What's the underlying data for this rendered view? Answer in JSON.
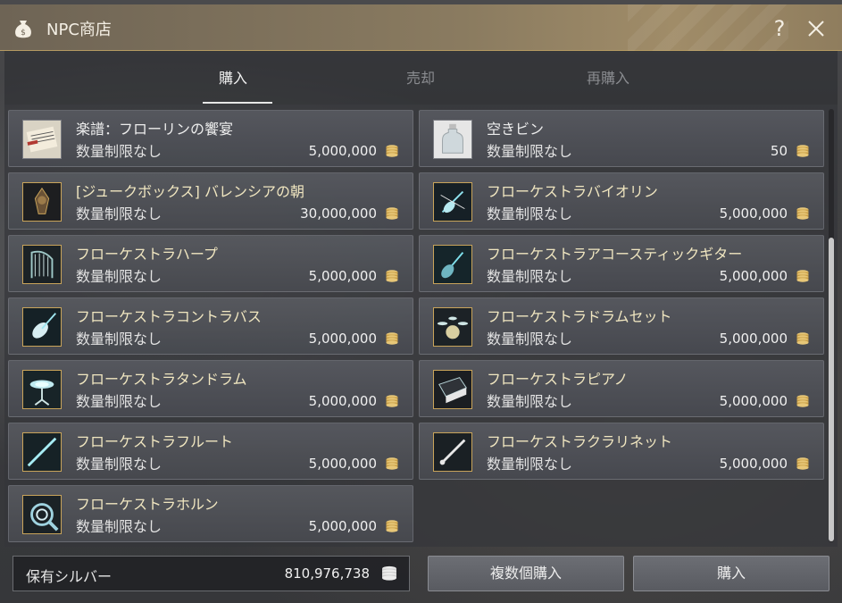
{
  "window": {
    "title": "NPC商店",
    "help_label": "?",
    "title_icon": "money-bag-icon",
    "close_icon": "close-icon"
  },
  "tabs": [
    {
      "label": "購入",
      "active": true
    },
    {
      "label": "売却",
      "active": false
    },
    {
      "label": "再購入",
      "active": false
    }
  ],
  "items": [
    {
      "name": "楽譜：フローリンの饗宴",
      "limit": "数量制限なし",
      "price": "5,000,000",
      "icon": "music-score-icon",
      "name_color": "white"
    },
    {
      "name": "空きビン",
      "limit": "数量制限なし",
      "price": "50",
      "icon": "empty-bottle-icon",
      "name_color": "white"
    },
    {
      "name": "[ジュークボックス] バレンシアの朝",
      "limit": "数量制限なし",
      "price": "30,000,000",
      "icon": "jukebox-icon",
      "name_color": "gold"
    },
    {
      "name": "フローケストラバイオリン",
      "limit": "数量制限なし",
      "price": "5,000,000",
      "icon": "violin-icon",
      "name_color": "gold"
    },
    {
      "name": "フローケストラハープ",
      "limit": "数量制限なし",
      "price": "5,000,000",
      "icon": "harp-icon",
      "name_color": "gold"
    },
    {
      "name": "フローケストラアコースティックギター",
      "limit": "数量制限なし",
      "price": "5,000,000",
      "icon": "guitar-icon",
      "name_color": "gold"
    },
    {
      "name": "フローケストラコントラバス",
      "limit": "数量制限なし",
      "price": "5,000,000",
      "icon": "contrabass-icon",
      "name_color": "gold"
    },
    {
      "name": "フローケストラドラムセット",
      "limit": "数量制限なし",
      "price": "5,000,000",
      "icon": "drum-set-icon",
      "name_color": "gold"
    },
    {
      "name": "フローケストラタンドラム",
      "limit": "数量制限なし",
      "price": "5,000,000",
      "icon": "tan-drum-icon",
      "name_color": "gold"
    },
    {
      "name": "フローケストラピアノ",
      "limit": "数量制限なし",
      "price": "5,000,000",
      "icon": "piano-icon",
      "name_color": "gold"
    },
    {
      "name": "フローケストラフルート",
      "limit": "数量制限なし",
      "price": "5,000,000",
      "icon": "flute-icon",
      "name_color": "gold"
    },
    {
      "name": "フローケストラクラリネット",
      "limit": "数量制限なし",
      "price": "5,000,000",
      "icon": "clarinet-icon",
      "name_color": "gold"
    },
    {
      "name": "フローケストラホルン",
      "limit": "数量制限なし",
      "price": "5,000,000",
      "icon": "horn-icon",
      "name_color": "gold"
    }
  ],
  "footer": {
    "silver_label": "保有シルバー",
    "silver_value": "810,976,738",
    "bulk_buy_label": "複数個購入",
    "buy_label": "購入"
  },
  "colors": {
    "title_bar": "#8a7b60",
    "item_name_gold": "#f0e6c0",
    "thumb_border_gold": "#c9a45a"
  }
}
